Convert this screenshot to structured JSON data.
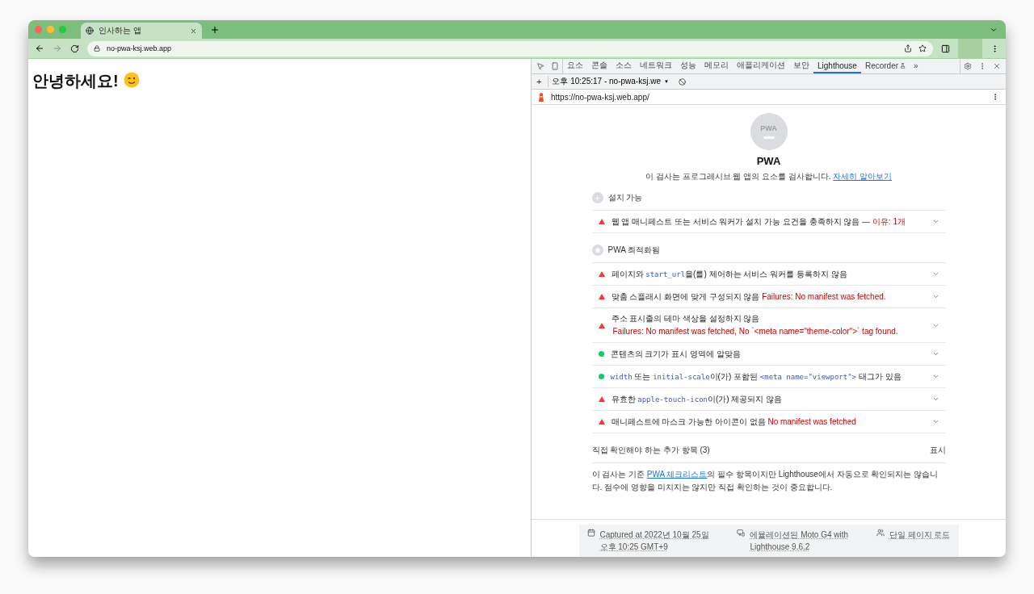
{
  "browser": {
    "tab": {
      "title": "인사하는 앱"
    },
    "url": "no-pwa-ksj.web.app"
  },
  "page": {
    "heading": "안녕하세요!"
  },
  "devtools": {
    "tabs": [
      {
        "label": "요소",
        "selected": false
      },
      {
        "label": "콘솔",
        "selected": false
      },
      {
        "label": "소스",
        "selected": false
      },
      {
        "label": "네트워크",
        "selected": false
      },
      {
        "label": "성능",
        "selected": false
      },
      {
        "label": "메모리",
        "selected": false
      },
      {
        "label": "애플리케이션",
        "selected": false
      },
      {
        "label": "보안",
        "selected": false
      },
      {
        "label": "Lighthouse",
        "selected": true
      },
      {
        "label": "Recorder",
        "selected": false
      }
    ],
    "more_tabs": "»",
    "report_bar": {
      "add": "+",
      "report": "오후 10:25:17 - no-pwa-ksj.we",
      "caret": "▼"
    },
    "report_url": "https://no-pwa-ksj.web.app/",
    "gauge": {
      "label": "PWA"
    },
    "title": "PWA",
    "description": "이 검사는 프로그레시브 웹 앱의 요소를 검사합니다.",
    "learn_more": "자세히 알아보기",
    "groups": [
      {
        "kind": "installable",
        "title": "설치 가능",
        "audits": [
          {
            "kind": "fail",
            "parts": [
              {
                "kind": "text",
                "text": "웹 앱 매니페스트 또는 서비스 워커가 설치 가능 요건을 충족하지 않음"
              },
              {
                "kind": "fail",
                "text": " — 이유: 1개"
              }
            ]
          }
        ]
      },
      {
        "kind": "optimized",
        "title": "PWA 최적화됨",
        "audits": [
          {
            "kind": "fail",
            "parts": [
              {
                "kind": "text",
                "text": "페이지와 "
              },
              {
                "kind": "code",
                "text": "start_url"
              },
              {
                "kind": "text",
                "text": "을(를) 제어하는 서비스 워커를 등록하지 않음"
              }
            ]
          },
          {
            "kind": "fail",
            "parts": [
              {
                "kind": "text",
                "text": "맞춤 스플래시 화면에 맞게 구성되지 않음 "
              },
              {
                "kind": "fail",
                "text": "Failures: No manifest was fetched."
              }
            ]
          },
          {
            "kind": "fail",
            "parts": [
              {
                "kind": "text",
                "text": "주소 표시줄의 테마 색상을 설정하지 않음"
              },
              {
                "kind": "failblock",
                "text": "Failures: No manifest was fetched, No `<meta name=\"theme-color\">` tag found."
              }
            ]
          },
          {
            "kind": "pass",
            "parts": [
              {
                "kind": "text",
                "text": "콘텐츠의 크기가 표시 영역에 알맞음"
              }
            ]
          },
          {
            "kind": "pass",
            "parts": [
              {
                "kind": "code",
                "text": "width"
              },
              {
                "kind": "text",
                "text": " 또는 "
              },
              {
                "kind": "code",
                "text": "initial-scale"
              },
              {
                "kind": "text",
                "text": "이(가) 포함된 "
              },
              {
                "kind": "code",
                "text": "<meta name=\"viewport\">"
              },
              {
                "kind": "text",
                "text": " 태그가 있음"
              }
            ]
          },
          {
            "kind": "fail",
            "parts": [
              {
                "kind": "text",
                "text": "유효한 "
              },
              {
                "kind": "code",
                "text": "apple-touch-icon"
              },
              {
                "kind": "text",
                "text": "이(가) 제공되지 않음"
              }
            ]
          },
          {
            "kind": "fail",
            "parts": [
              {
                "kind": "text",
                "text": "매니페스트에 마스크 가능한 아이콘이 없음 "
              },
              {
                "kind": "fail",
                "text": "No manifest was fetched"
              }
            ]
          }
        ]
      }
    ],
    "manual": {
      "title": "직접 확인해야 하는 추가 항목 (3)",
      "toggle": "표시",
      "before": "이 검사는 기준 ",
      "link": "PWA 체크리스트",
      "after": "의 필수 항목이지만 Lighthouse에서 자동으로 확인되지는 않습니다. 점수에 영향을 미치지는 않지만 직접 확인하는 것이 중요합니다."
    },
    "footer": [
      {
        "kind": "calendar",
        "lines": [
          "Captured at 2022년 10월 25일",
          "오후 10:25 GMT+9"
        ]
      },
      {
        "kind": "device",
        "lines": [
          "에뮬레이션된 Moto G4 with",
          "Lighthouse 9.6.2"
        ]
      },
      {
        "kind": "person",
        "lines": [
          "단일 페이지 로드"
        ]
      }
    ]
  }
}
